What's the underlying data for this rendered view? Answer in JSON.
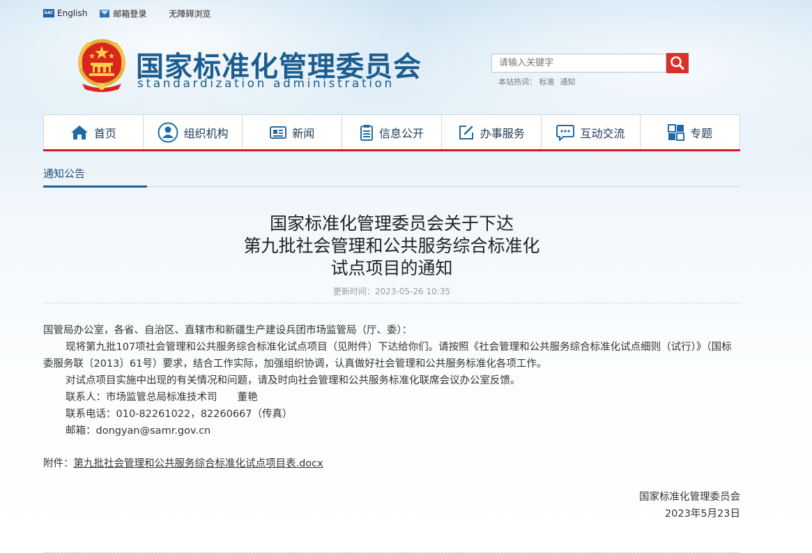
{
  "top_links": {
    "english": "English",
    "mail_login": "邮箱登录",
    "accessibility": "无障碍浏览",
    "sac_icon": "SAC"
  },
  "logo": {
    "name_cn": "国家标准化管理委员会",
    "name_en": "standardization administration"
  },
  "search": {
    "placeholder": "请输入关键字",
    "hot_label": "本站热词：",
    "hot_words": [
      "标准",
      "通知"
    ]
  },
  "nav": {
    "items": [
      {
        "label": "首页",
        "icon": "home-icon"
      },
      {
        "label": "组织机构",
        "icon": "user-icon"
      },
      {
        "label": "新闻",
        "icon": "newspaper-icon"
      },
      {
        "label": "信息公开",
        "icon": "clipboard-icon"
      },
      {
        "label": "办事服务",
        "icon": "edit-icon"
      },
      {
        "label": "互动交流",
        "icon": "chat-icon"
      },
      {
        "label": "专题",
        "icon": "topic-icon"
      }
    ]
  },
  "breadcrumb": "通知公告",
  "article": {
    "title_lines": [
      "国家标准化管理委员会关于下达",
      "第九批社会管理和公共服务综合标准化",
      "试点项目的通知"
    ],
    "updated": "更新时间：2023-05-26 10:35",
    "salutation": "国管局办公室，各省、自治区、直辖市和新疆生产建设兵团市场监管局（厅、委）：",
    "para1": "现将第九批107项社会管理和公共服务综合标准化试点项目（见附件）下达给你们。请按照《社会管理和公共服务综合标准化试点细则（试行）》（国标委服务联〔2013〕61号）要求，结合工作实际，加强组织协调，认真做好社会管理和公共服务标准化各项工作。",
    "para2": "对试点项目实施中出现的有关情况和问题，请及时向社会管理和公共服务标准化联席会议办公室反馈。",
    "contact": "联系人：市场监管总局标准技术司　　董艳",
    "phone": "联系电话：010-82261022，82260667（传真）",
    "email": "邮箱：dongyan@samr.gov.cn",
    "attachment_label": "附件：",
    "attachment_link": "第九批社会管理和公共服务综合标准化试点项目表.docx",
    "sign_org": "国家标准化管理委员会",
    "sign_date": "2023年5月23日"
  },
  "colors": {
    "brand_blue": "#1b5d8e",
    "nav_red": "#d7151f",
    "search_red": "#d9322b"
  }
}
